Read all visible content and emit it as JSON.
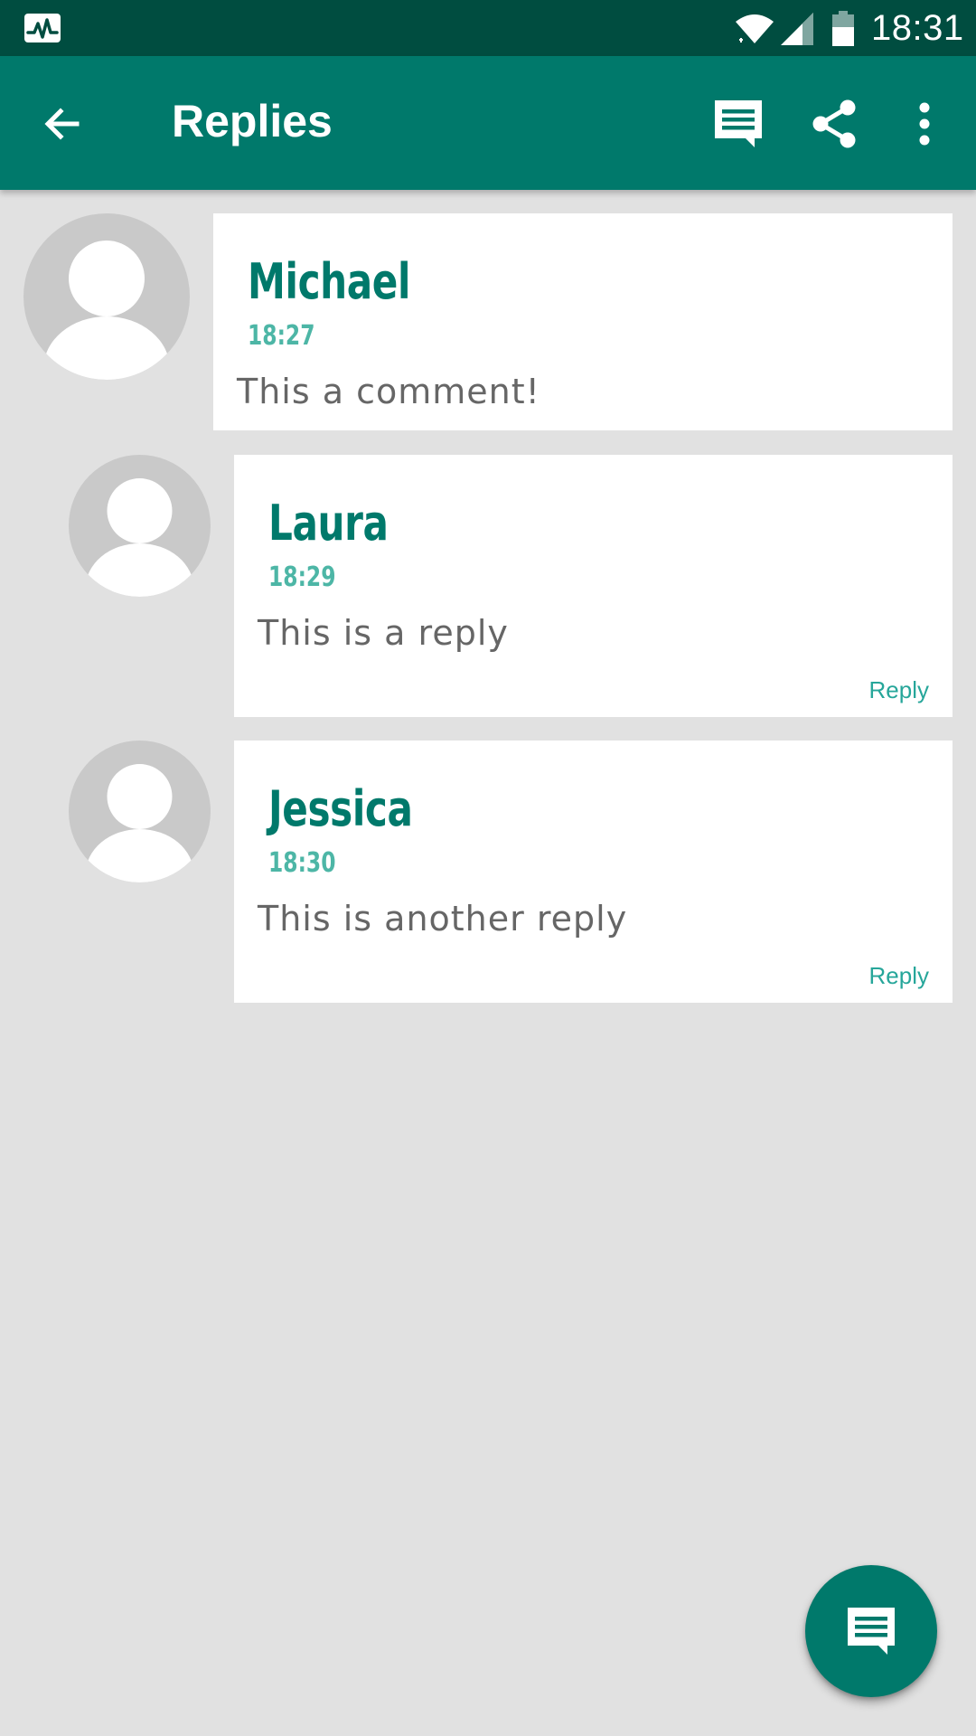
{
  "status_bar": {
    "time": "18:31",
    "icons": [
      "activity-icon",
      "wifi-icon",
      "cell-signal-icon",
      "battery-icon"
    ]
  },
  "app_bar": {
    "title": "Replies",
    "actions": [
      "back-arrow-icon",
      "comment-icon",
      "share-icon",
      "more-vert-icon"
    ]
  },
  "comments": [
    {
      "author": "Michael",
      "time": "18:27",
      "text": "This a comment!",
      "reply_label": ""
    },
    {
      "author": "Laura",
      "time": "18:29",
      "text": "This is a reply",
      "reply_label": "Reply"
    },
    {
      "author": "Jessica",
      "time": "18:30",
      "text": "This is another reply",
      "reply_label": "Reply"
    }
  ],
  "fab": {
    "icon": "comment-icon"
  },
  "colors": {
    "status_bar": "#004d40",
    "app_bar": "#00796b",
    "background": "#e1e1e1",
    "author": "#00796b",
    "time": "#4db6a6",
    "reply": "#26a69a"
  }
}
